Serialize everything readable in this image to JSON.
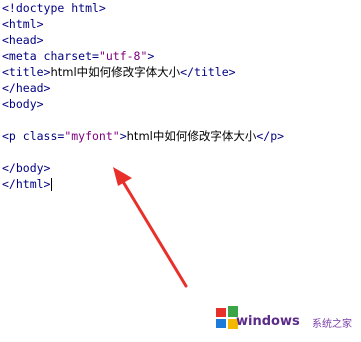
{
  "code": {
    "l1": "<!doctype html>",
    "l2": "<html>",
    "l3": "<head>",
    "l4_pre": "<meta charset=",
    "l4_str": "\"utf-8\"",
    "l4_post": ">",
    "l5_tag1": "<title>",
    "l5_text": "html中如何修改字体大小",
    "l5_tag2": "</title>",
    "l6": "</head>",
    "l7": "<body>",
    "l9_tag1": "<p class=",
    "l9_str": "\"myfont\"",
    "l9_gt": ">",
    "l9_text": "html中如何修改字体大小",
    "l9_tag2": "</p>",
    "l11": "</body>",
    "l12": "</html>"
  },
  "watermark": {
    "text": "windows",
    "sub": "系统之家",
    "icon": "windows-logo-icon"
  },
  "colors": {
    "tag": "#000080",
    "string": "#800080",
    "text": "#000000",
    "arrow": "#e8302a"
  }
}
